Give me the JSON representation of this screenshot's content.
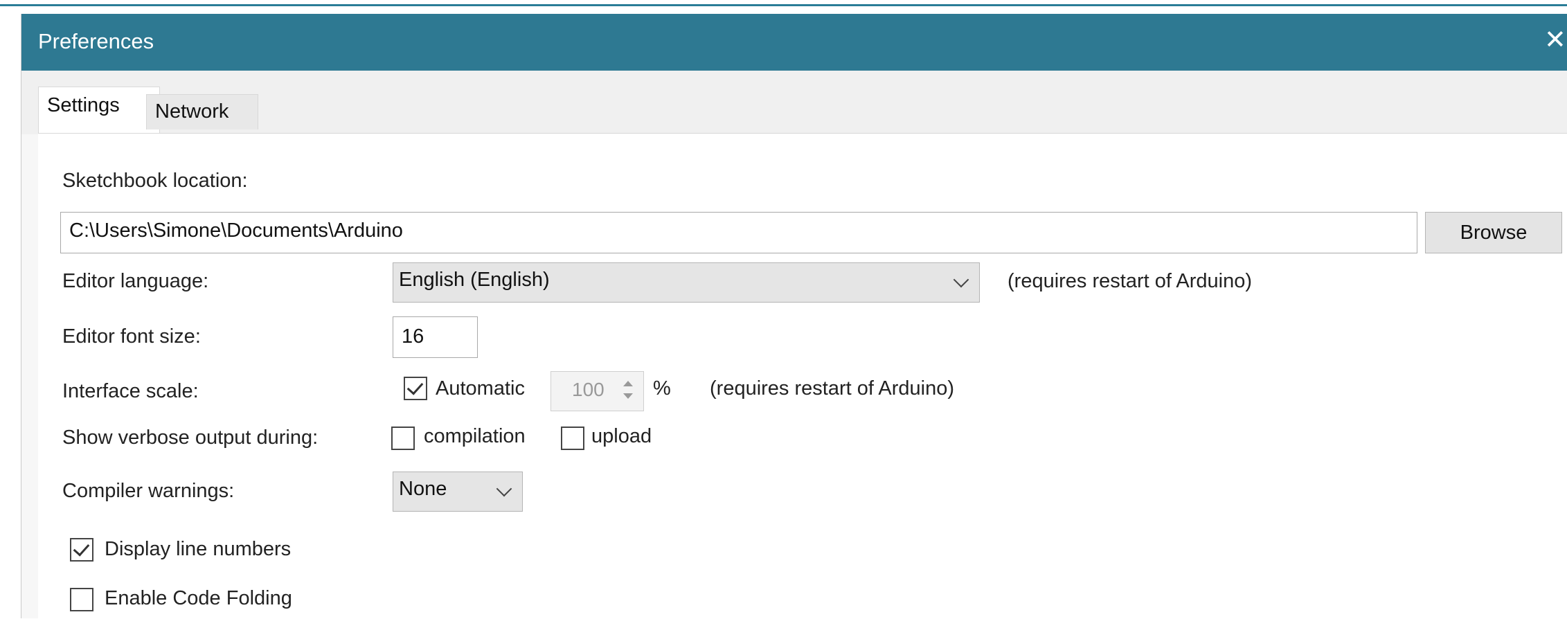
{
  "window": {
    "title": "Preferences",
    "close_glyph": "✕"
  },
  "tabs": [
    {
      "label": "Settings",
      "active": true
    },
    {
      "label": "Network",
      "active": false
    }
  ],
  "settings": {
    "sketchbook": {
      "label": "Sketchbook location:",
      "value": "C:\\Users\\Simone\\Documents\\Arduino",
      "browse_label": "Browse"
    },
    "editor_language": {
      "label": "Editor language:",
      "value": "English (English)",
      "note": "(requires restart of Arduino)"
    },
    "editor_font_size": {
      "label": "Editor font size:",
      "value": "16"
    },
    "interface_scale": {
      "label": "Interface scale:",
      "automatic_label": "Automatic",
      "automatic_checked": true,
      "value": "100",
      "unit": "%",
      "note": "(requires restart of Arduino)"
    },
    "verbose_output": {
      "label": "Show verbose output during:",
      "compilation_label": "compilation",
      "compilation_checked": false,
      "upload_label": "upload",
      "upload_checked": false
    },
    "compiler_warnings": {
      "label": "Compiler warnings:",
      "value": "None"
    },
    "display_line_numbers": {
      "label": "Display line numbers",
      "checked": true
    },
    "enable_code_folding": {
      "label": "Enable Code Folding",
      "checked": false
    }
  },
  "colors": {
    "titlebar": "#2e7992",
    "panel_background": "#ffffff",
    "window_background": "#f0f0f0"
  },
  "icons": {
    "close": "close-icon",
    "dropdown": "chevron-down-icon",
    "checkmark": "checkmark-icon",
    "spinner": "spinner-arrows-icon"
  }
}
